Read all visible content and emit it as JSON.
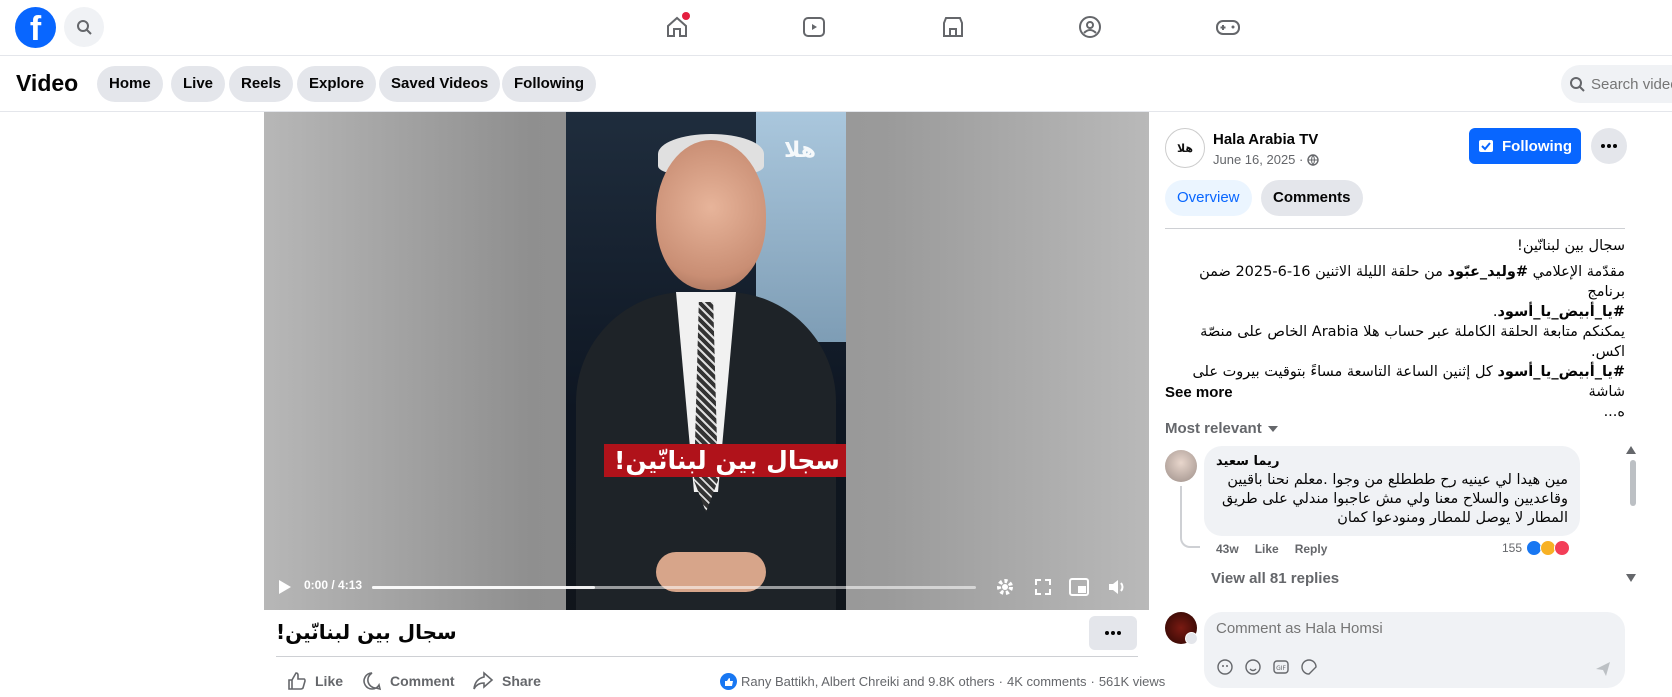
{
  "topbar": {
    "logo": "f",
    "nav_icons": [
      "home-icon",
      "reels-icon",
      "marketplace-icon",
      "groups-icon",
      "gaming-icon"
    ]
  },
  "subbar": {
    "title": "Video",
    "pills": [
      "Home",
      "Live",
      "Reels",
      "Explore",
      "Saved Videos",
      "Following"
    ],
    "search_placeholder": "Search videos"
  },
  "player": {
    "watermark": "هلا",
    "caption": "سجال بين لبنانّين!",
    "time": "0:00 / 4:13",
    "progress_fraction": 0.0,
    "buffer_fraction": 0.37
  },
  "video": {
    "title": "سجال بين لبنانّين!",
    "actions": [
      "Like",
      "Comment",
      "Share"
    ],
    "reactions_text": "Rany Battikh, Albert Chreiki and 9.8K others",
    "comments_count": "4K comments",
    "views": "561K views"
  },
  "sidebar": {
    "avatar_text": "هلا",
    "page_name": "Hala Arabia TV",
    "date": "June 16, 2025 ·",
    "following_label": "Following",
    "tabs": [
      "Overview",
      "Comments"
    ],
    "desc_line1": "سجال بين لبنانّين!",
    "desc_line2_pre": "مقدّمة الإعلامي ",
    "desc_line2_tag": "#وليد_عبّود",
    "desc_line2_post": " من حلقة الليلة الاثنين 16-6-2025 ضمن برنامج",
    "desc_line3_tag": "#يا_أبيض_يا_أسود",
    "desc_line3_post": ".",
    "desc_line4": "يمكنكم متابعة الحلقة الكاملة عبر حساب هلا Arabia الخاص على منصّة",
    "desc_line5": "اكس.",
    "desc_line6_tag": "#يا_أبيض_يا_أسود",
    "desc_line6_post": " كل إثنين الساعة التاسعة مساءً بتوقيت بيروت على شاشة",
    "desc_line7": "ه...",
    "see_more": "See more",
    "sort_label": "Most relevant"
  },
  "comment": {
    "author": "ريما سعيد",
    "text": "مين هيدا لي عينيه رح طططلع من وجوا .معلم نحنا باقيين وقاعديين والسلاح معنا ولي مش عاجبوا مندلي على طريق المطار لا يوصل للمطار ومنودعوا كمان",
    "time": "43w",
    "like_label": "Like",
    "reply_label": "Reply",
    "reaction_count": "155",
    "view_replies": "View all 81 replies"
  },
  "composer": {
    "placeholder": "Comment as Hala Homsi"
  },
  "colors": {
    "brand": "#0866ff",
    "notification": "#e41e3f",
    "caption_bg": "#b0121a"
  }
}
